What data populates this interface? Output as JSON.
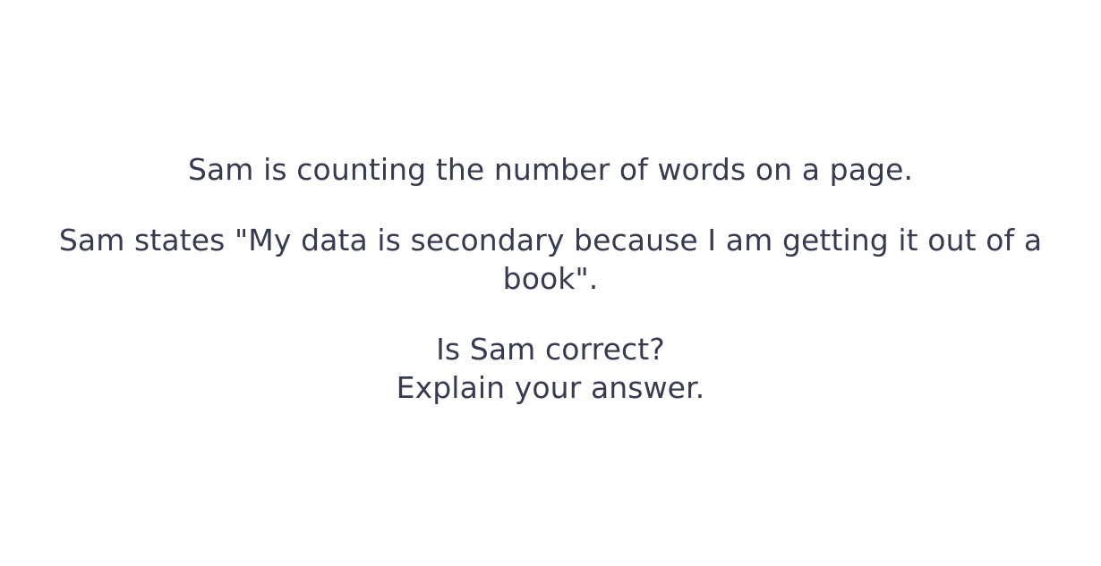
{
  "question": {
    "line1": "Sam is counting the number of words on a page.",
    "line2": "Sam states \"My data is secondary because I am getting it out of a book\".",
    "line3": "Is Sam correct?",
    "line4": "Explain your answer."
  },
  "colors": {
    "text": "#363b4f",
    "background": "#ffffff"
  }
}
